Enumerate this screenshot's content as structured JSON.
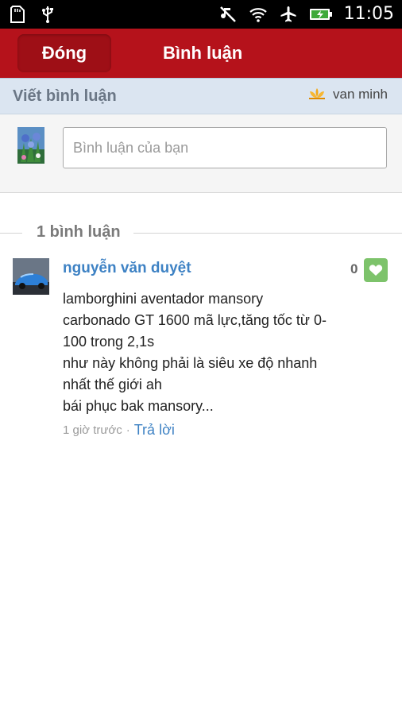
{
  "status_bar": {
    "time": "11:05",
    "icons": [
      "sd-card-icon",
      "usb-icon",
      "mute-icon",
      "wifi-icon",
      "airplane-icon",
      "battery-charging-icon"
    ]
  },
  "app_bar": {
    "close_label": "Đóng",
    "title": "Bình luận"
  },
  "write_section": {
    "title": "Viết bình luận",
    "user_name": "van minh",
    "input_placeholder": "Bình luận của bạn"
  },
  "comments_header": {
    "count_label": "1 bình luận"
  },
  "comments": [
    {
      "author": "nguyễn văn duyệt",
      "likes": "0",
      "lines": [
        "lamborghini aventador mansory",
        "carbonado GT 1600 mã lực,tăng tốc từ 0-",
        "100 trong 2,1s",
        "như này không phải là siêu xe độ nhanh",
        "nhất thế giới ah",
        "bái phục bak mansory..."
      ],
      "time": "1 giờ trước",
      "reply_label": "Trả lời"
    }
  ],
  "colors": {
    "app_bar": "#b5121b",
    "link": "#3e82c4",
    "like_button": "#7dc36b",
    "write_bar": "#dbe5f1"
  }
}
